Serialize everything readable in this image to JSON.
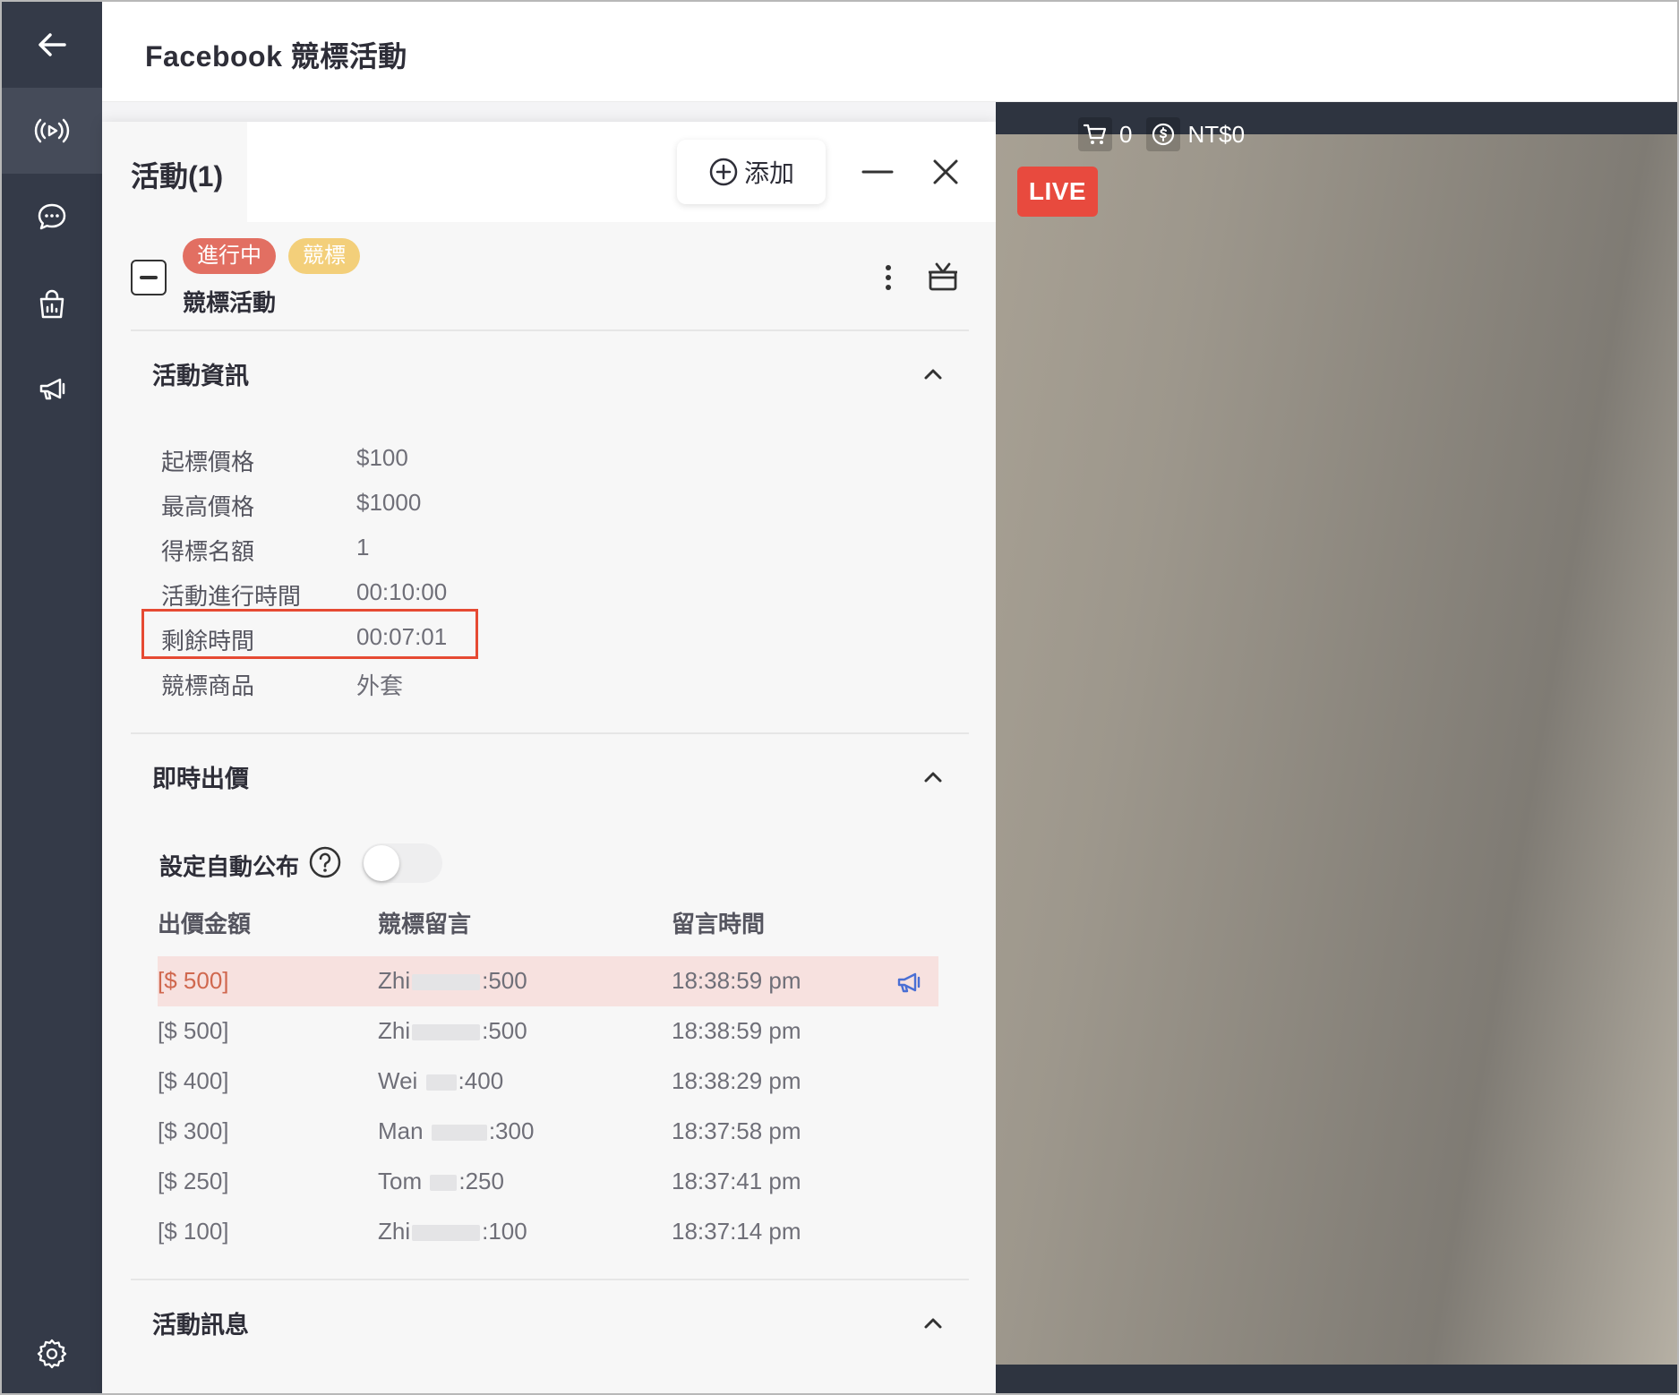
{
  "header": {
    "title": "Facebook 競標活動"
  },
  "panel": {
    "title": "活動(1)",
    "add_label": "添加"
  },
  "event": {
    "status_badge": "進行中",
    "type_badge": "競標",
    "name": "競標活動"
  },
  "info_section": {
    "title": "活動資訊",
    "rows": [
      {
        "label": "起標價格",
        "value": "$100"
      },
      {
        "label": "最高價格",
        "value": "$1000"
      },
      {
        "label": "得標名額",
        "value": "1"
      },
      {
        "label": "活動進行時間",
        "value": "00:10:00"
      },
      {
        "label": "剩餘時間",
        "value": "00:07:01"
      },
      {
        "label": "競標商品",
        "value": "外套"
      }
    ]
  },
  "bids_section": {
    "title": "即時出價",
    "auto_publish_label": "設定自動公布",
    "auto_publish_on": false,
    "columns": [
      "出價金額",
      "競標留言",
      "留言時間"
    ],
    "rows": [
      {
        "amount": "[$ 500]",
        "name": "Zhi",
        "suffix": ":500",
        "time": "18:38:59 pm"
      },
      {
        "amount": "[$ 500]",
        "name": "Zhi",
        "suffix": ":500",
        "time": "18:38:59 pm"
      },
      {
        "amount": "[$ 400]",
        "name": "Wei",
        "suffix": ":400",
        "time": "18:38:29 pm"
      },
      {
        "amount": "[$ 300]",
        "name": "Man",
        "suffix": ":300",
        "time": "18:37:58 pm"
      },
      {
        "amount": "[$ 250]",
        "name": "Tom",
        "suffix": ":250",
        "time": "18:37:41 pm"
      },
      {
        "amount": "[$ 100]",
        "name": "Zhi",
        "suffix": ":100",
        "time": "18:37:14 pm"
      }
    ]
  },
  "messages_section": {
    "title": "活動訊息"
  },
  "video": {
    "cart_count": "0",
    "amount": "NT$0",
    "live_label": "LIVE"
  },
  "colors": {
    "rail": "#343a48",
    "live_badge": "#e84a3e",
    "status_badge": "#e26f62",
    "type_badge": "#f3cf7a",
    "highlight_border": "#e64a33",
    "top_bid_row": "#f7e1df"
  },
  "icons": [
    "back-arrow-icon",
    "broadcast-icon",
    "chat-bubble-icon",
    "shopping-bag-icon",
    "megaphone-icon",
    "settings-gear-icon",
    "plus-circle-icon",
    "minimize-icon",
    "close-icon",
    "more-vertical-icon",
    "gift-box-icon",
    "chevron-up-icon",
    "help-circle-icon",
    "pin-megaphone-icon",
    "cart-icon",
    "dollar-circle-icon"
  ]
}
